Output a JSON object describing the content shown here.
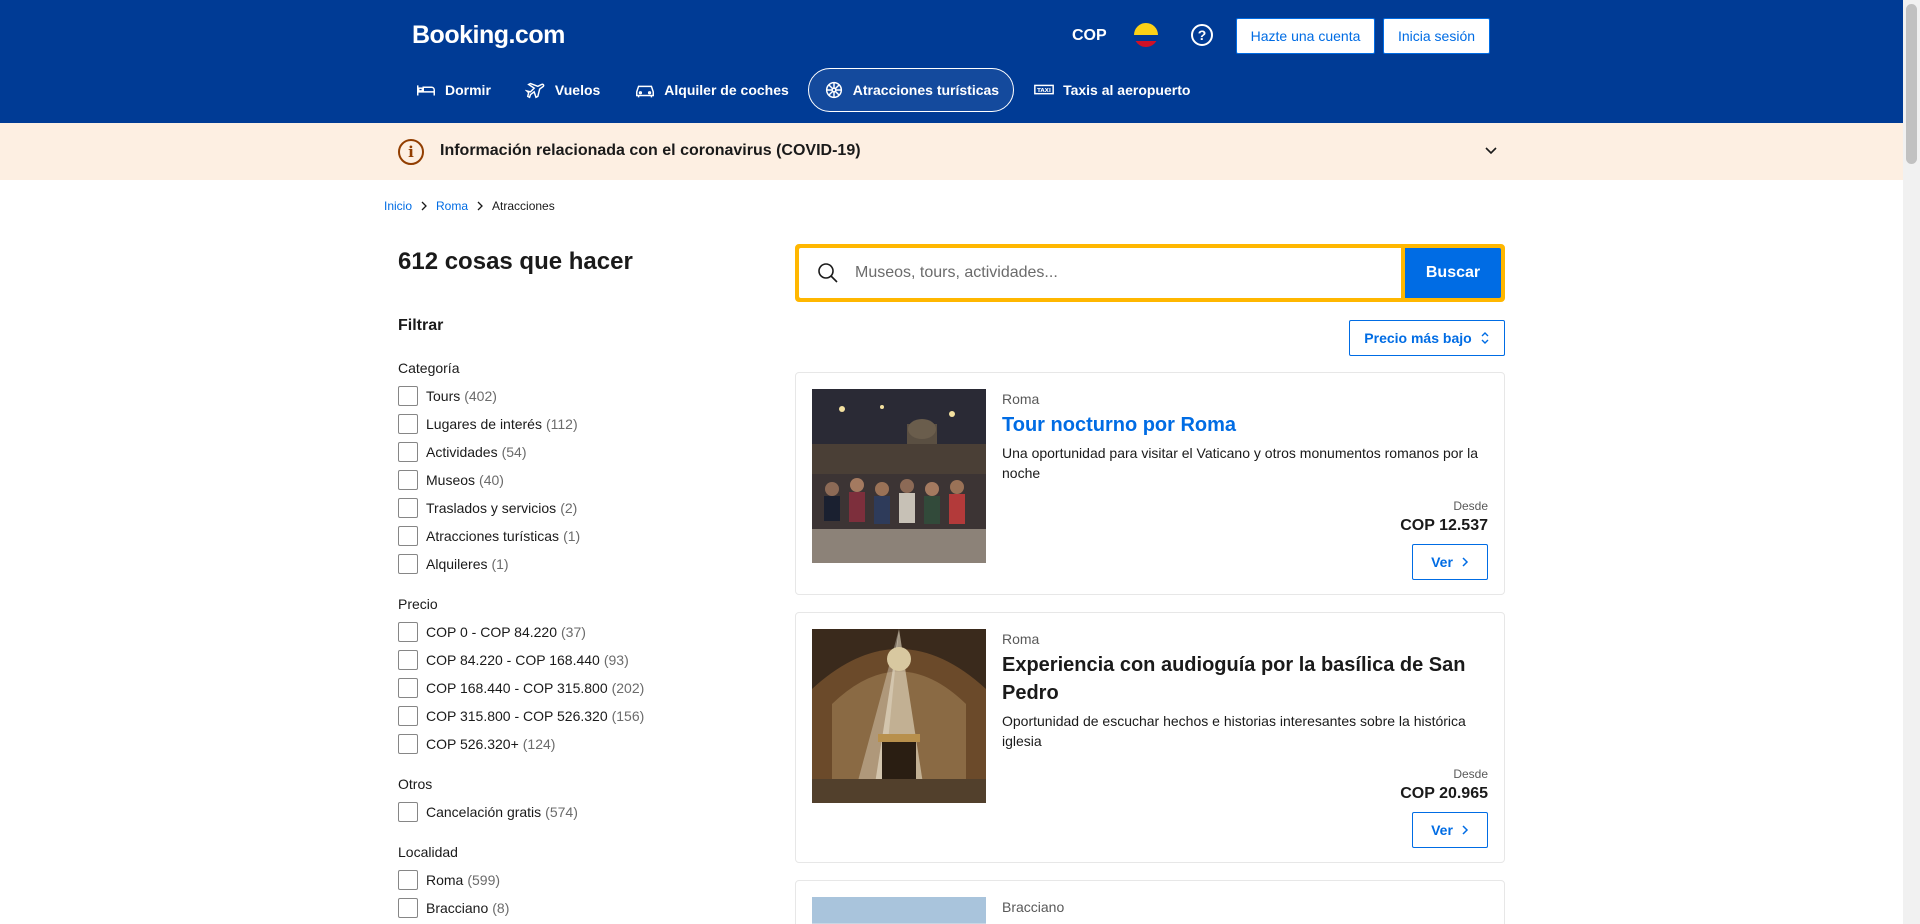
{
  "header": {
    "logo": "Booking.com",
    "currency": "COP",
    "help": "?",
    "register_label": "Hazte una cuenta",
    "login_label": "Inicia sesión",
    "nav": [
      {
        "label": "Dormir",
        "icon": "bed-icon"
      },
      {
        "label": "Vuelos",
        "icon": "plane-icon"
      },
      {
        "label": "Alquiler de coches",
        "icon": "car-icon"
      },
      {
        "label": "Atracciones turísticas",
        "icon": "attractions-icon",
        "active": true
      },
      {
        "label": "Taxis al aeropuerto",
        "icon": "taxi-icon"
      }
    ]
  },
  "banner": {
    "info_glyph": "i",
    "text": "Información relacionada con el coronavirus (COVID-19)"
  },
  "breadcrumb": {
    "items": [
      "Inicio",
      "Roma",
      "Atracciones"
    ]
  },
  "main": {
    "count_title": "612 cosas que hacer",
    "filter_title": "Filtrar",
    "filters": [
      {
        "title": "Categoría",
        "options": [
          {
            "label": "Tours",
            "count": "(402)"
          },
          {
            "label": "Lugares de interés",
            "count": "(112)"
          },
          {
            "label": "Actividades",
            "count": "(54)"
          },
          {
            "label": "Museos",
            "count": "(40)"
          },
          {
            "label": "Traslados y servicios",
            "count": "(2)"
          },
          {
            "label": "Atracciones turísticas",
            "count": "(1)"
          },
          {
            "label": "Alquileres",
            "count": "(1)"
          }
        ]
      },
      {
        "title": "Precio",
        "options": [
          {
            "label": "COP 0 - COP 84.220",
            "count": "(37)"
          },
          {
            "label": "COP 84.220 - COP 168.440",
            "count": "(93)"
          },
          {
            "label": "COP 168.440 - COP 315.800",
            "count": "(202)"
          },
          {
            "label": "COP 315.800 - COP 526.320",
            "count": "(156)"
          },
          {
            "label": "COP 526.320+",
            "count": "(124)"
          }
        ]
      },
      {
        "title": "Otros",
        "options": [
          {
            "label": "Cancelación gratis",
            "count": "(574)"
          }
        ]
      },
      {
        "title": "Localidad",
        "options": [
          {
            "label": "Roma",
            "count": "(599)"
          },
          {
            "label": "Bracciano",
            "count": "(8)"
          }
        ]
      }
    ],
    "search": {
      "placeholder": "Museos, tours, actividades...",
      "button": "Buscar"
    },
    "sort_label": "Precio más bajo",
    "results": [
      {
        "location": "Roma",
        "title": "Tour nocturno por Roma",
        "description": "Una oportunidad para visitar el Vaticano y otros monumentos romanos por la noche",
        "from_label": "Desde",
        "price": "COP 12.537",
        "button": "Ver"
      },
      {
        "location": "Roma",
        "title": "Experiencia con audioguía por la basílica de San Pedro",
        "description": "Oportunidad de escuchar hechos e historias interesantes sobre la histórica iglesia",
        "from_label": "Desde",
        "price": "COP 20.965",
        "button": "Ver"
      },
      {
        "location": "Bracciano"
      }
    ]
  },
  "colors": {
    "header_bg": "#003b95",
    "accent": "#006ce4",
    "search_border": "#ffb700",
    "banner_bg": "#fdefe2"
  }
}
